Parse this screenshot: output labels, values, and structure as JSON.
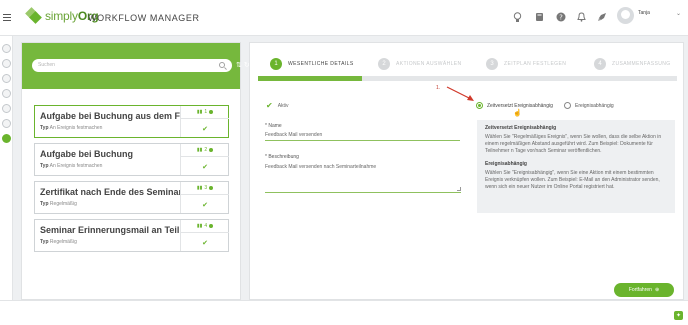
{
  "brand": {
    "logo_light": "simply",
    "logo_bold": "Org",
    "app_title": "WORKFLOW MANAGER",
    "accent": "#6ab42d"
  },
  "header": {
    "icons": [
      "lightbulb-icon",
      "book-icon",
      "help-icon",
      "bell-icon",
      "rocket-icon"
    ],
    "user_name": "Tanja"
  },
  "sidebar": {
    "search_placeholder": "Suchen"
  },
  "workflows": [
    {
      "title": "Aufgabe bei Buchung aus dem Fr...",
      "type_label": "Typ",
      "type_value": "An Ereignis festmachen",
      "count": "1",
      "selected": true
    },
    {
      "title": "Aufgabe bei Buchung",
      "type_label": "Typ",
      "type_value": "An Ereignis festmachen",
      "count": "2",
      "selected": false
    },
    {
      "title": "Zertifikat nach Ende des Seminar...",
      "type_label": "Typ",
      "type_value": "Regelmäßig",
      "count": "3",
      "selected": false
    },
    {
      "title": "Seminar Erinnerungsmail an Teil...",
      "type_label": "Typ",
      "type_value": "Regelmäßig",
      "count": "4",
      "selected": false
    }
  ],
  "steps": [
    {
      "num": "1",
      "label": "WESENTLICHE DETAILS"
    },
    {
      "num": "2",
      "label": "AKTIONEN AUSWÄHLEN"
    },
    {
      "num": "3",
      "label": "ZEITPLAN FESTLEGEN"
    },
    {
      "num": "4",
      "label": "ZUSAMMENFASSUNG"
    }
  ],
  "form": {
    "active_label": "Aktiv",
    "name_label": "* Name",
    "name_value": "Feedback Mail versenden",
    "desc_label": "* Beschreibung",
    "desc_value": "Feedback Mail versenden nach Seminarteilnahme"
  },
  "annotation": "1.",
  "radios": {
    "option1": "Zeitversetzt Ereignisabhängig",
    "option2": "Ereignisabhängig"
  },
  "info": {
    "h1": "Zeitversetzt Ereignisabhängig",
    "p1": "Wählen Sie \"Regelmäßiges Ereignis\", wenn Sie wollen, dass die selbe Aktion in einem regelmäßigen Abstand ausgeführt wird. Zum Beispiel: Dokumente für Teilnehmer n Tage vor/nach Seminar veröffentlichen.",
    "h2": "Ereignisabhängig",
    "p2": "Wählen Sie \"Ereignisabhängig\", wenn Sie eine Aktion mit einem bestimmten Ereignis verknüpfen wollen. Zum Beispiel: E-Mail an den Administrator senden, wenn sich ein neuer Nutzer im Online Portal registriert hat."
  },
  "next_button": "Fortfahren"
}
